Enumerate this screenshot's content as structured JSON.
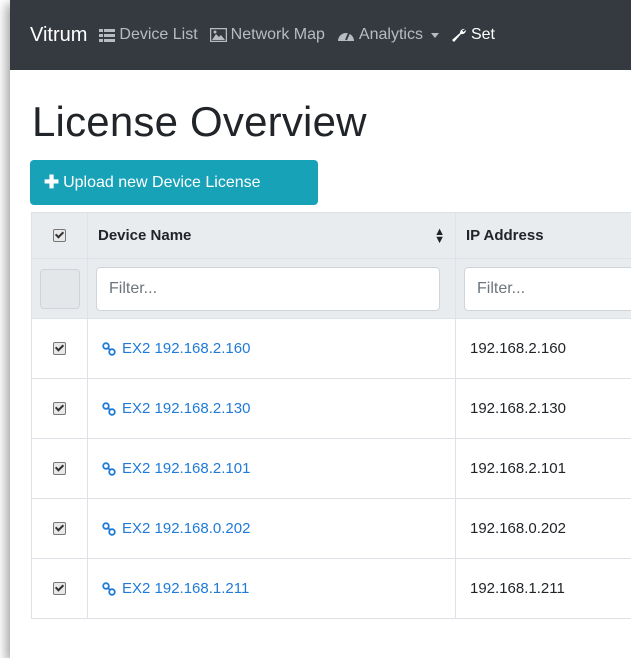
{
  "navbar": {
    "brand": "Vitrum",
    "items": [
      {
        "label": "Device List",
        "icon": "list-icon"
      },
      {
        "label": "Network Map",
        "icon": "image-icon"
      },
      {
        "label": "Analytics",
        "icon": "dashboard-icon"
      },
      {
        "label": "Set",
        "icon": "wrench-icon"
      }
    ]
  },
  "page": {
    "title": "License Overview",
    "upload_button": "Upload new Device License"
  },
  "table": {
    "columns": [
      "Device Name",
      "IP Address"
    ],
    "filter_placeholder": "Filter...",
    "rows": [
      {
        "device": "EX2 192.168.2.160",
        "ip": "192.168.2.160"
      },
      {
        "device": "EX2 192.168.2.130",
        "ip": "192.168.2.130"
      },
      {
        "device": "EX2 192.168.2.101",
        "ip": "192.168.2.101"
      },
      {
        "device": "EX2 192.168.0.202",
        "ip": "192.168.0.202"
      },
      {
        "device": "EX2 192.168.1.211",
        "ip": "192.168.1.211"
      }
    ]
  },
  "colors": {
    "navbar": "#343a40",
    "button": "#17a2b8",
    "link": "#1f7ad8"
  }
}
